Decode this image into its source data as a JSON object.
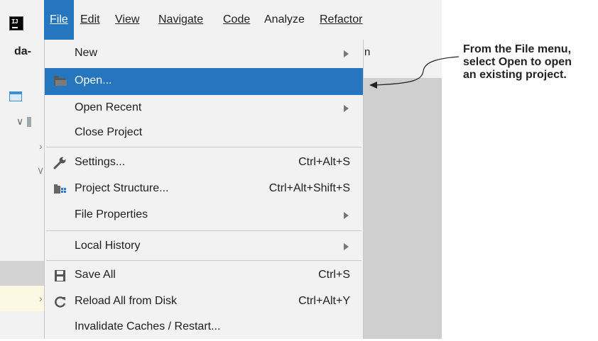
{
  "menubar": {
    "items": [
      {
        "label": "File",
        "underline_index": 0
      },
      {
        "label": "Edit",
        "underline_index": 0
      },
      {
        "label": "View",
        "underline_index": 0
      },
      {
        "label": "Navigate",
        "underline_index": 0
      },
      {
        "label": "Code",
        "underline_index": 0
      },
      {
        "label": "Analyze",
        "underline_index": 5
      },
      {
        "label": "Refactor",
        "underline_index": 0
      }
    ],
    "logo_text": "IJ"
  },
  "project": {
    "name_fragment": "da-",
    "toolbar_tail": "n"
  },
  "file_menu": {
    "items": [
      {
        "label": "New",
        "mnemonic": "N",
        "shortcut": "",
        "submenu": true,
        "icon": ""
      },
      {
        "label": "Open...",
        "mnemonic": "O",
        "shortcut": "",
        "submenu": false,
        "icon": "folder-icon",
        "highlighted": true
      },
      {
        "label": "Open Recent",
        "mnemonic": "R",
        "shortcut": "",
        "submenu": true,
        "icon": ""
      },
      {
        "label": "Close Project",
        "mnemonic": "",
        "shortcut": "",
        "submenu": false,
        "icon": ""
      },
      {
        "label": "Settings...",
        "mnemonic": "t",
        "shortcut": "Ctrl+Alt+S",
        "submenu": false,
        "icon": "wrench-icon"
      },
      {
        "label": "Project Structure...",
        "mnemonic": "",
        "shortcut": "Ctrl+Alt+Shift+S",
        "submenu": false,
        "icon": "project-structure-icon"
      },
      {
        "label": "File Properties",
        "mnemonic": "",
        "shortcut": "",
        "submenu": true,
        "icon": ""
      },
      {
        "label": "Local History",
        "mnemonic": "H",
        "shortcut": "",
        "submenu": true,
        "icon": ""
      },
      {
        "label": "Save All",
        "mnemonic": "S",
        "shortcut": "Ctrl+S",
        "submenu": false,
        "icon": "save-icon"
      },
      {
        "label": "Reload All from Disk",
        "mnemonic": "",
        "shortcut": "Ctrl+Alt+Y",
        "submenu": false,
        "icon": "reload-icon"
      },
      {
        "label": "Invalidate Caches / Restart...",
        "mnemonic": "",
        "shortcut": "",
        "submenu": false,
        "icon": ""
      }
    ]
  },
  "annotation": {
    "lines": [
      "From the File menu,",
      "select Open to open",
      "an existing project."
    ]
  },
  "colors": {
    "highlight": "#2675bf",
    "menu_bg": "#f2f2f2"
  }
}
